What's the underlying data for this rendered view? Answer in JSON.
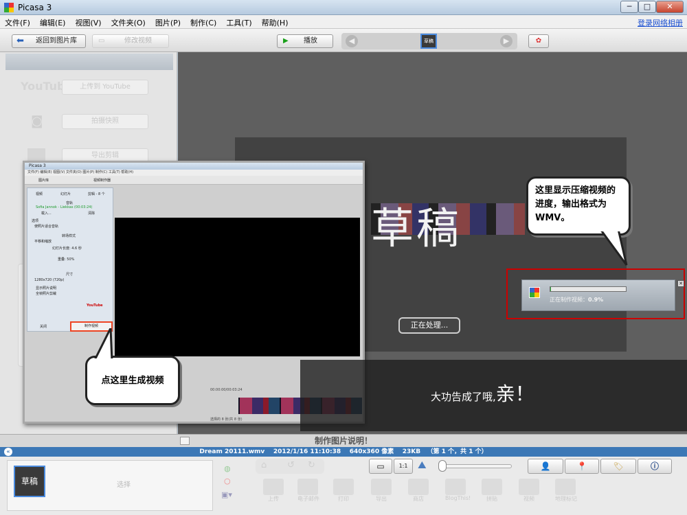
{
  "window": {
    "title": "Picasa 3",
    "min": "─",
    "max": "□",
    "close": "✕"
  },
  "menu": {
    "items": [
      "文件(F)",
      "编辑(E)",
      "视图(V)",
      "文件夹(O)",
      "图片(P)",
      "制作(C)",
      "工具(T)",
      "帮助(H)"
    ],
    "login": "登录网络相册"
  },
  "toolbar": {
    "back_label": "返回到图片库",
    "edit_video_label": "修改视频",
    "play_label": "播放",
    "thumb_label": "草稿"
  },
  "left_panel": {
    "youtube_logo": "YouTube",
    "upload_label": "上传到 YouTube",
    "snapshot_label": "拍摄快照",
    "export_label": "导出剪辑"
  },
  "preview": {
    "slide_title": "草稿",
    "processing_label": "正在处理..."
  },
  "inner_screenshot": {
    "title": "Picasa 3",
    "menu": "文件(F)  编辑(E)  视图(V)  文件夹(O)  图片(P)  制作(C)  工具(T)  帮助(H)",
    "tab_library": "图片库",
    "tab_video": "视频制作器",
    "panel_tabs": [
      "视频",
      "幻灯片",
      "剪辑 - 8 个"
    ],
    "music_label": "音轨",
    "music_track": "Sofia Jannok - Liekkas (00:03:24)",
    "load_label": "载入...",
    "clear_label": "清除",
    "options_label": "选项",
    "options_value": "使照片适合音轨",
    "transition_label": "转场样式",
    "transition_value": "平移和缩放",
    "slide_duration": "幻灯片长度: 4.6 秒",
    "overlap_label": "重叠: 50%",
    "size_label": "尺寸",
    "size_value": "1280x720 (720p)",
    "check_caption": "显示照片说明",
    "check_full": "全帧照片剪裁",
    "youtube_label": "YouTube",
    "close_label": "关闭",
    "make_label": "制作视频",
    "time_label": "00:00:00/00:03:24",
    "status_label": "选择的 8 张(共 8 张)"
  },
  "callouts": {
    "make_video": "点这里生成视频",
    "progress_note": "这里显示压缩视频的进度，输出格式为WMV。"
  },
  "progress": {
    "text": "正在制作视频：",
    "percent_text": "0.9%",
    "value": 0.9,
    "close": "✕"
  },
  "done": {
    "text": "大功告成了哦,",
    "big": "亲！"
  },
  "caption": "制作图片说明！",
  "infobar": {
    "filename": "Dream 20111.wmv",
    "datetime": "2012/1/16 11:10:38",
    "dimensions": "640x360 像素",
    "size": "23KB",
    "count": "（第 1 个，共 1 个）"
  },
  "bottom": {
    "thumb_label": "草稿",
    "select_label": "选择",
    "actions": [
      "上传",
      "电子邮件",
      "打印",
      "导出",
      "商店",
      "BlogThis!",
      "拼贴",
      "视频",
      "地理标记"
    ]
  },
  "colors": {
    "accent": "#3c78b6",
    "highlight": "#cc0000",
    "progress": "#2da83c"
  }
}
